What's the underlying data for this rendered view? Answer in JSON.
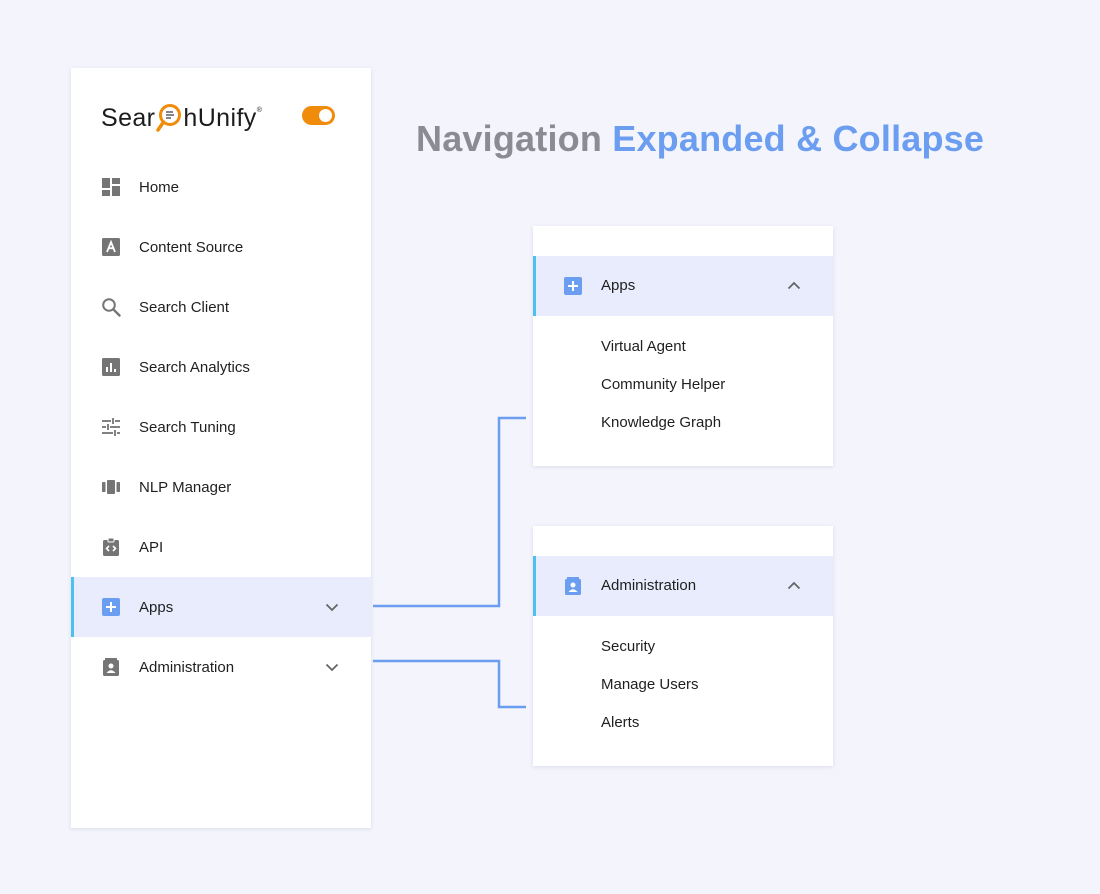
{
  "logo": {
    "text_before": "Sear",
    "text_after": "hUnify",
    "registered": "®"
  },
  "theme_toggle": {
    "state": "on",
    "color": "#f08c0a"
  },
  "heading": {
    "part1": "Navigation",
    "part2": "Expanded & Collapse"
  },
  "colors": {
    "accent": "#6b9df0",
    "active_bg": "#e8ecfc",
    "active_bar": "#4ec0ee",
    "icon_gray": "#757575",
    "brand_orange": "#f08c0a"
  },
  "sidebar": {
    "items": [
      {
        "label": "Home",
        "icon": "dashboard-icon"
      },
      {
        "label": "Content Source",
        "icon": "content-source-icon"
      },
      {
        "label": "Search Client",
        "icon": "search-icon"
      },
      {
        "label": "Search Analytics",
        "icon": "analytics-icon"
      },
      {
        "label": "Search Tuning",
        "icon": "tuning-sliders-icon"
      },
      {
        "label": "NLP Manager",
        "icon": "nlp-icon"
      },
      {
        "label": "API",
        "icon": "api-clipboard-icon"
      },
      {
        "label": "Apps",
        "icon": "apps-plus-icon",
        "expandable": true,
        "active": true
      },
      {
        "label": "Administration",
        "icon": "admin-badge-icon",
        "expandable": true
      }
    ]
  },
  "panels": {
    "apps": {
      "label": "Apps",
      "icon": "apps-plus-icon",
      "items": [
        "Virtual Agent",
        "Community Helper",
        "Knowledge Graph"
      ]
    },
    "administration": {
      "label": "Administration",
      "icon": "admin-badge-icon",
      "items": [
        "Security",
        "Manage Users",
        "Alerts"
      ]
    }
  }
}
